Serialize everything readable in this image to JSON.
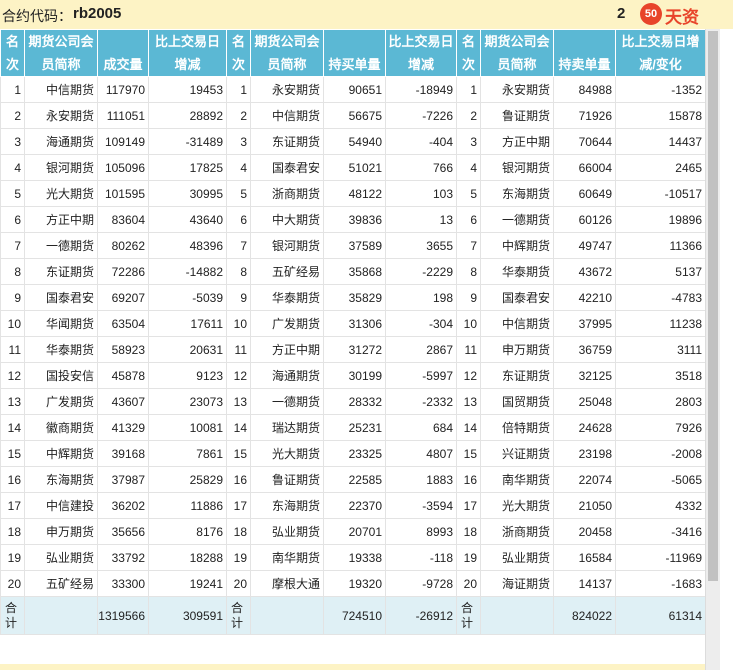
{
  "header": {
    "contract_label": "合约代码：",
    "contract_code": "rb2005",
    "date_partial": "2",
    "logo_badge": "50",
    "logo_text": "天资"
  },
  "columns": {
    "rank": [
      "名",
      "次"
    ],
    "vol_member": [
      "期货公司会",
      "员简称"
    ],
    "volume": [
      "",
      "成交量"
    ],
    "vol_change": [
      "比上交易日",
      "增减"
    ],
    "long_member": [
      "期货公司会",
      "员简称"
    ],
    "long_qty": [
      "",
      "持买单量"
    ],
    "long_change": [
      "比上交易日",
      "增减"
    ],
    "short_member": [
      "期货公司会",
      "员简称"
    ],
    "short_qty": [
      "",
      "持卖单量"
    ],
    "short_change": [
      "比上交易日增",
      "减/变化"
    ]
  },
  "rows": [
    [
      "1",
      "中信期货",
      "117970",
      "19453",
      "1",
      "永安期货",
      "90651",
      "-18949",
      "1",
      "永安期货",
      "84988",
      "-1352"
    ],
    [
      "2",
      "永安期货",
      "111051",
      "28892",
      "2",
      "中信期货",
      "56675",
      "-7226",
      "2",
      "鲁证期货",
      "71926",
      "15878"
    ],
    [
      "3",
      "海通期货",
      "109149",
      "-31489",
      "3",
      "东证期货",
      "54940",
      "-404",
      "3",
      "方正中期",
      "70644",
      "14437"
    ],
    [
      "4",
      "银河期货",
      "105096",
      "17825",
      "4",
      "国泰君安",
      "51021",
      "766",
      "4",
      "银河期货",
      "66004",
      "2465"
    ],
    [
      "5",
      "光大期货",
      "101595",
      "30995",
      "5",
      "浙商期货",
      "48122",
      "103",
      "5",
      "东海期货",
      "60649",
      "-10517"
    ],
    [
      "6",
      "方正中期",
      "83604",
      "43640",
      "6",
      "中大期货",
      "39836",
      "13",
      "6",
      "一德期货",
      "60126",
      "19896"
    ],
    [
      "7",
      "一德期货",
      "80262",
      "48396",
      "7",
      "银河期货",
      "37589",
      "3655",
      "7",
      "中辉期货",
      "49747",
      "11366"
    ],
    [
      "8",
      "东证期货",
      "72286",
      "-14882",
      "8",
      "五矿经易",
      "35868",
      "-2229",
      "8",
      "华泰期货",
      "43672",
      "5137"
    ],
    [
      "9",
      "国泰君安",
      "69207",
      "-5039",
      "9",
      "华泰期货",
      "35829",
      "198",
      "9",
      "国泰君安",
      "42210",
      "-4783"
    ],
    [
      "10",
      "华闻期货",
      "63504",
      "17611",
      "10",
      "广发期货",
      "31306",
      "-304",
      "10",
      "中信期货",
      "37995",
      "11238"
    ],
    [
      "11",
      "华泰期货",
      "58923",
      "20631",
      "11",
      "方正中期",
      "31272",
      "2867",
      "11",
      "申万期货",
      "36759",
      "3111"
    ],
    [
      "12",
      "国投安信",
      "45878",
      "9123",
      "12",
      "海通期货",
      "30199",
      "-5997",
      "12",
      "东证期货",
      "32125",
      "3518"
    ],
    [
      "13",
      "广发期货",
      "43607",
      "23073",
      "13",
      "一德期货",
      "28332",
      "-2332",
      "13",
      "国贸期货",
      "25048",
      "2803"
    ],
    [
      "14",
      "徽商期货",
      "41329",
      "10081",
      "14",
      "瑞达期货",
      "25231",
      "684",
      "14",
      "倍特期货",
      "24628",
      "7926"
    ],
    [
      "15",
      "中辉期货",
      "39168",
      "7861",
      "15",
      "光大期货",
      "23325",
      "4807",
      "15",
      "兴证期货",
      "23198",
      "-2008"
    ],
    [
      "16",
      "东海期货",
      "37987",
      "25829",
      "16",
      "鲁证期货",
      "22585",
      "1883",
      "16",
      "南华期货",
      "22074",
      "-5065"
    ],
    [
      "17",
      "中信建投",
      "36202",
      "11886",
      "17",
      "东海期货",
      "22370",
      "-3594",
      "17",
      "光大期货",
      "21050",
      "4332"
    ],
    [
      "18",
      "申万期货",
      "35656",
      "8176",
      "18",
      "弘业期货",
      "20701",
      "8993",
      "18",
      "浙商期货",
      "20458",
      "-3416"
    ],
    [
      "19",
      "弘业期货",
      "33792",
      "18288",
      "19",
      "南华期货",
      "19338",
      "-118",
      "19",
      "弘业期货",
      "16584",
      "-11969"
    ],
    [
      "20",
      "五矿经易",
      "33300",
      "19241",
      "20",
      "摩根大通",
      "19320",
      "-9728",
      "20",
      "海证期货",
      "14137",
      "-1683"
    ]
  ],
  "totals": {
    "label": "合计",
    "volume": "1319566",
    "vol_change": "309591",
    "long_qty": "724510",
    "long_change": "-26912",
    "short_qty": "824022",
    "short_change": "61314"
  },
  "colors": {
    "header_bg": "#5bb8d4",
    "topbar_bg": "#fdf3c5",
    "total_row_bg": "#dff0f5",
    "logo_red": "#e8442a"
  }
}
